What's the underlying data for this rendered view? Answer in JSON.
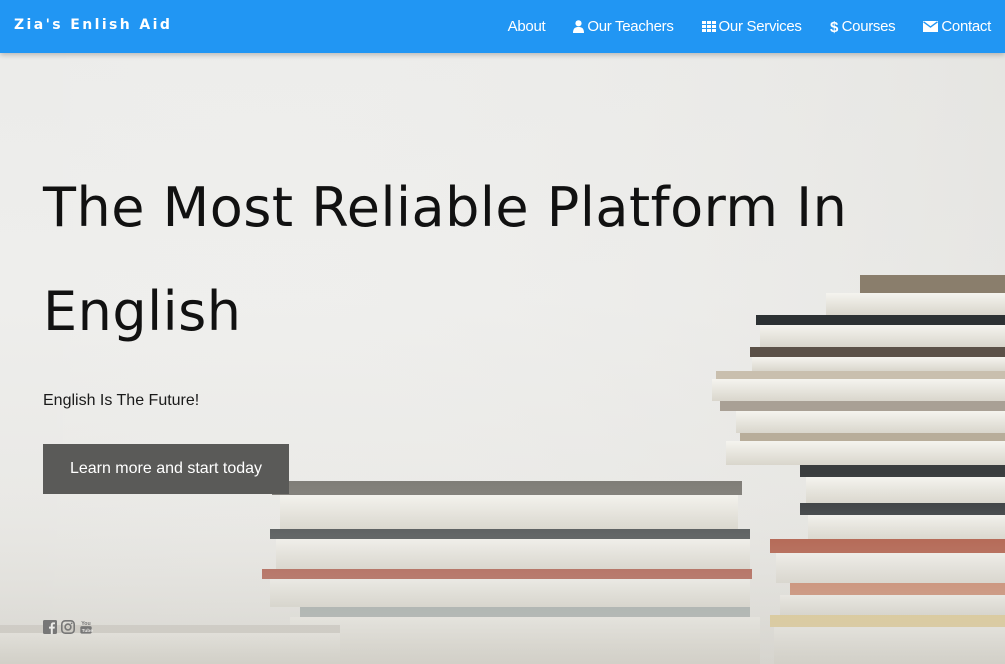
{
  "navbar": {
    "brand": "Zia's Enlish Aid",
    "links": [
      {
        "label": "About",
        "icon": ""
      },
      {
        "label": "Our Teachers",
        "icon": "user-icon"
      },
      {
        "label": "Our Services",
        "icon": "grid-icon"
      },
      {
        "label": "Courses",
        "icon": "dollar-icon"
      },
      {
        "label": "Contact",
        "icon": "envelope-icon"
      }
    ],
    "color": "#2196f3"
  },
  "hero": {
    "title": "The Most Reliable Platform In English",
    "subtitle": "English Is The Future!",
    "cta_label": "Learn more and start today",
    "background": "books-stack-photo"
  },
  "social": [
    "facebook-icon",
    "instagram-icon",
    "youtube-icon"
  ]
}
